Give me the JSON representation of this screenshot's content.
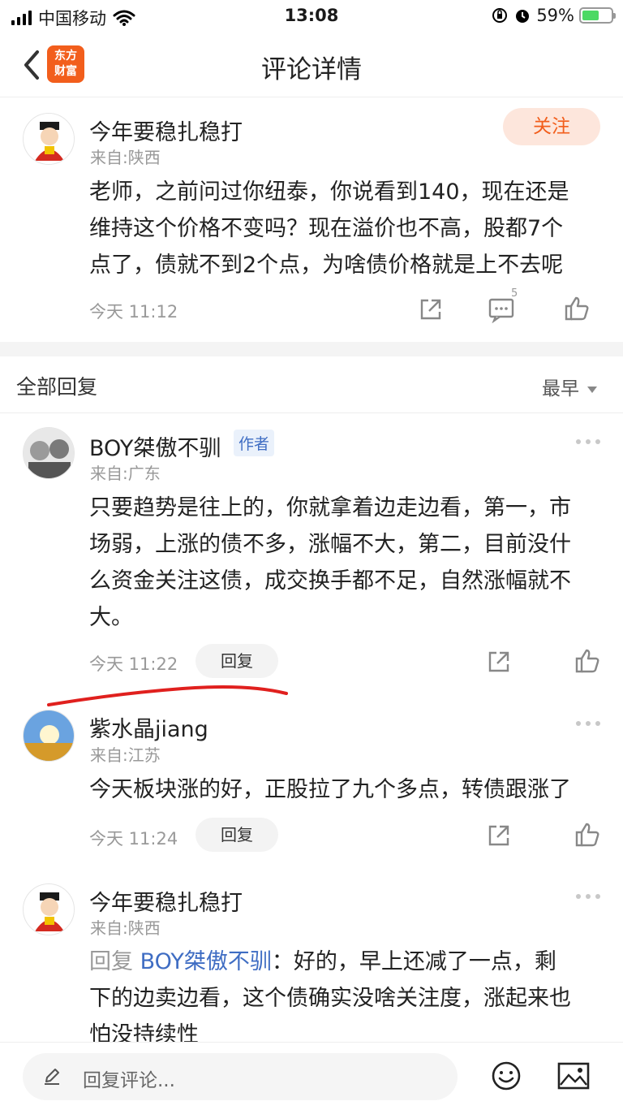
{
  "status_bar": {
    "carrier": "中国移动",
    "time": "13:08",
    "battery_percent": "59%",
    "battery_level": 0.59
  },
  "nav": {
    "logo_line1": "东方",
    "logo_line2": "财富",
    "title": "评论详情"
  },
  "main_comment": {
    "username": "今年要稳扎稳打",
    "from": "来自:陕西",
    "follow_label": "关注",
    "text_lines": [
      "老师，之前问过你纽泰，你说看到140，现在还是",
      "维持这个价格不变吗？现在溢价也不高，股都7个",
      "点了，债就不到2个点，为啥债价格就是上不去呢"
    ],
    "time": "今天 11:12",
    "comment_count": "5"
  },
  "replies_header": {
    "title": "全部回复",
    "sort_label": "最早"
  },
  "replies": [
    {
      "username": "BOY桀傲不驯",
      "tag": "作者",
      "from": "来自:广东",
      "text_lines": [
        "只要趋势是往上的，你就拿着边走边看，第一，市",
        "场弱，上涨的债不多，涨幅不大，第二，目前没什",
        "么资金关注这债，成交换手都不足，自然涨幅就不",
        "大。"
      ],
      "time": "今天 11:22",
      "reply_label": "回复"
    },
    {
      "username": "紫水晶jiang",
      "from": "来自:江苏",
      "text_lines": [
        "今天板块涨的好，正股拉了九个多点，转债跟涨了"
      ],
      "time": "今天 11:24",
      "reply_label": "回复"
    },
    {
      "username": "今年要稳扎稳打",
      "from": "来自:陕西",
      "reply_prefix": "回复 ",
      "reply_to": "BOY桀傲不驯",
      "reply_sep": "：",
      "text_first": "好的，早上还减了一点，剩",
      "text_lines": [
        "下的边卖边看，这个债确实没啥关注度，涨起来也",
        "怕没持续性"
      ]
    }
  ],
  "bottom_bar": {
    "input_placeholder": "回复评论..."
  },
  "icons": [
    "signal-icon",
    "wifi-icon",
    "orientation-lock-icon",
    "alarm-icon",
    "battery-icon",
    "back-icon",
    "share-icon",
    "comment-icon",
    "like-icon",
    "more-icon",
    "pen-icon",
    "emoji-icon",
    "image-icon"
  ],
  "colors": {
    "brand": "#f25e1c",
    "follow_bg": "#fde6dc",
    "link": "#3f6dc3",
    "annotation": "#e0201e"
  }
}
